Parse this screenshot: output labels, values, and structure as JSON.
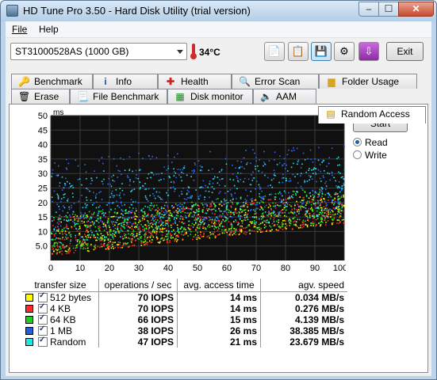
{
  "window": {
    "title": "HD Tune Pro 3.50 - Hard Disk Utility (trial version)",
    "min": "–",
    "max": "☐",
    "close": "✕"
  },
  "menu": {
    "file": "File",
    "help": "Help"
  },
  "toolbar": {
    "drive": "ST31000528AS (1000 GB)",
    "temperature": "34°C",
    "exit": "Exit"
  },
  "tabs_top": [
    {
      "label": "Benchmark",
      "icon": "benchmark-icon"
    },
    {
      "label": "Info",
      "icon": "info-icon"
    },
    {
      "label": "Health",
      "icon": "health-icon"
    },
    {
      "label": "Error Scan",
      "icon": "error-scan-icon"
    },
    {
      "label": "Folder Usage",
      "icon": "folder-usage-icon"
    }
  ],
  "tabs_bottom": [
    {
      "label": "Erase",
      "icon": "erase-icon"
    },
    {
      "label": "File Benchmark",
      "icon": "file-benchmark-icon"
    },
    {
      "label": "Disk monitor",
      "icon": "disk-monitor-icon"
    },
    {
      "label": "AAM",
      "icon": "aam-icon"
    },
    {
      "label": "Random Access",
      "icon": "random-access-icon",
      "selected": true
    }
  ],
  "controls": {
    "start": "Start",
    "read": "Read",
    "write": "Write",
    "mode": "read"
  },
  "chart_data": {
    "type": "scatter",
    "ylabel": "ms",
    "ylim": [
      0,
      50
    ],
    "xlim": [
      0,
      100
    ],
    "y_ticks": [
      "5.0",
      "10",
      "15",
      "20",
      "25",
      "30",
      "35",
      "40",
      "45",
      "50"
    ],
    "x_ticks": [
      "0",
      "10",
      "20",
      "30",
      "40",
      "50",
      "60",
      "70",
      "80",
      "90",
      "100%"
    ],
    "grid": true,
    "background": "#000000",
    "series": [
      {
        "name": "512 bytes",
        "color": "#ffff00",
        "y_at_x0": [
          2,
          15
        ],
        "y_at_x100": [
          13,
          24
        ]
      },
      {
        "name": "4 KB",
        "color": "#ff2a2a",
        "y_at_x0": [
          2,
          15
        ],
        "y_at_x100": [
          13,
          24
        ]
      },
      {
        "name": "64 KB",
        "color": "#22dd22",
        "y_at_x0": [
          3,
          16
        ],
        "y_at_x100": [
          14,
          26
        ]
      },
      {
        "name": "1 MB",
        "color": "#2b6cff",
        "y_at_x0": [
          10,
          36
        ],
        "y_at_x100": [
          18,
          40
        ]
      },
      {
        "name": "Random",
        "color": "#22e5e5",
        "y_at_x0": [
          6,
          30
        ],
        "y_at_x100": [
          16,
          36
        ]
      }
    ]
  },
  "results": {
    "headers": [
      "transfer size",
      "operations / sec",
      "avg. access time",
      "agv. speed"
    ],
    "rows": [
      {
        "name": "512 bytes",
        "color": "#ffff00",
        "iops": "70 IOPS",
        "access": "14 ms",
        "speed": "0.034 MB/s"
      },
      {
        "name": "4 KB",
        "color": "#ff2a2a",
        "iops": "70 IOPS",
        "access": "14 ms",
        "speed": "0.276 MB/s"
      },
      {
        "name": "64 KB",
        "color": "#22cc22",
        "iops": "66 IOPS",
        "access": "15 ms",
        "speed": "4.139 MB/s"
      },
      {
        "name": "1 MB",
        "color": "#1f5fd8",
        "iops": "38 IOPS",
        "access": "26 ms",
        "speed": "38.385 MB/s"
      },
      {
        "name": "Random",
        "color": "#22e5e5",
        "iops": "47 IOPS",
        "access": "21 ms",
        "speed": "23.679 MB/s"
      }
    ]
  }
}
